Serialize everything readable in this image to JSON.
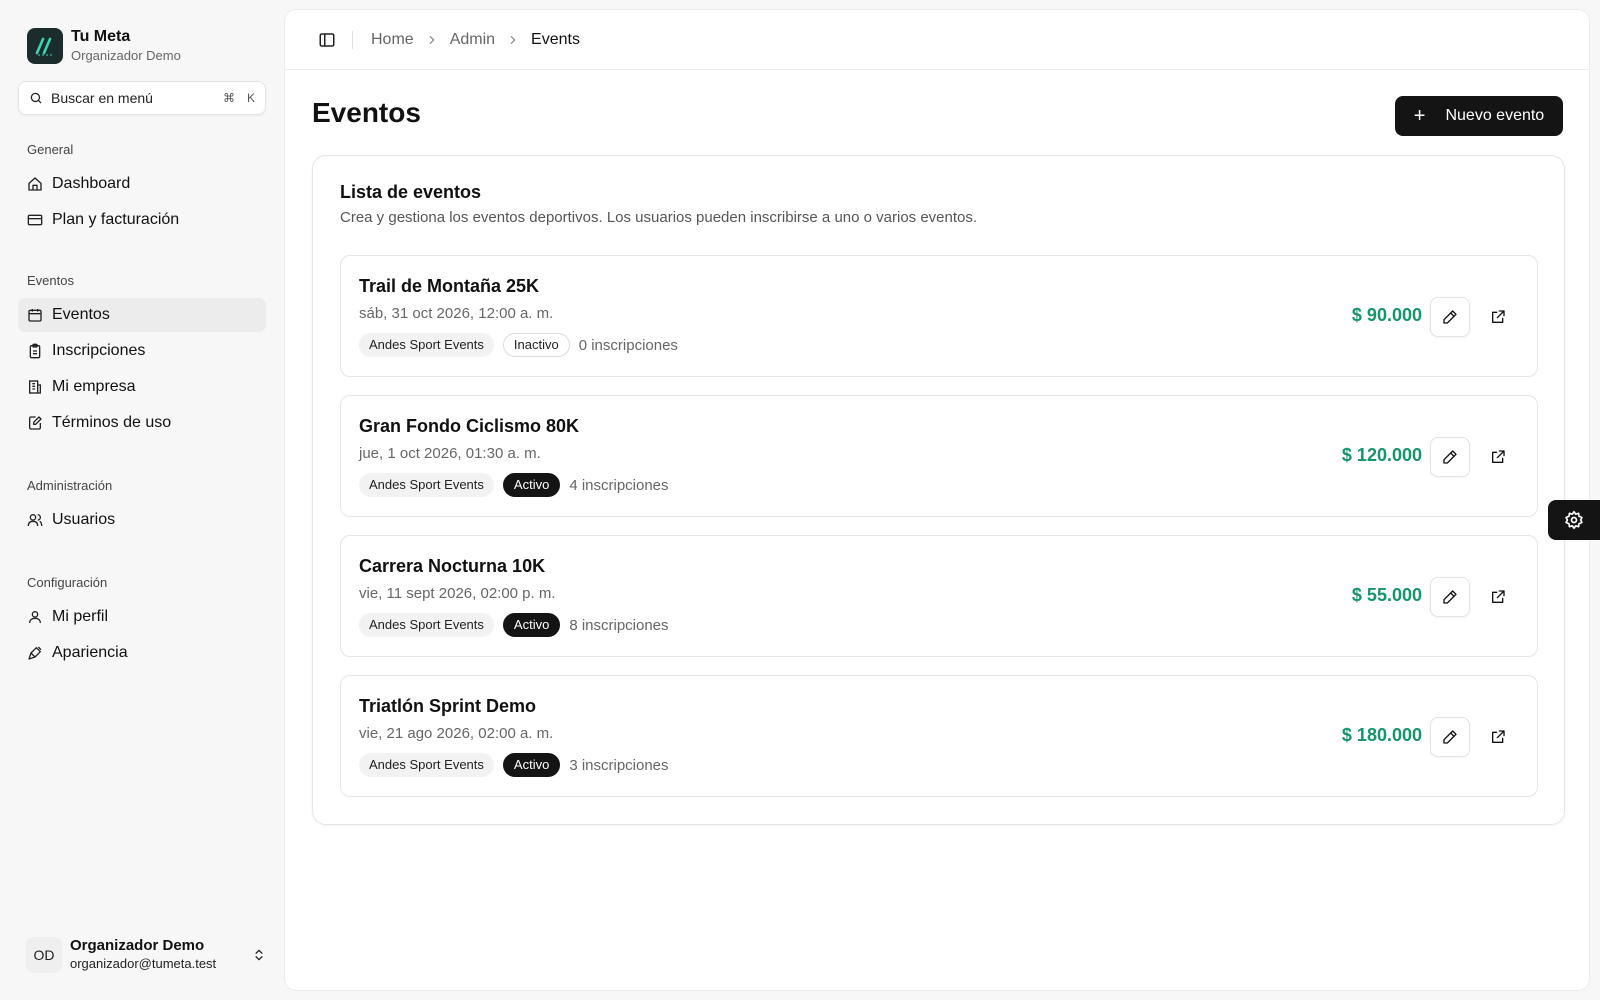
{
  "brand": {
    "name": "Tu Meta",
    "subtitle": "Organizador Demo"
  },
  "search": {
    "label": "Buscar en menú",
    "kbd_cmd": "⌘",
    "kbd_key": "K"
  },
  "nav": {
    "general": {
      "label": "General",
      "items": [
        "Dashboard",
        "Plan y facturación"
      ]
    },
    "eventos": {
      "label": "Eventos",
      "items": [
        "Eventos",
        "Inscripciones",
        "Mi empresa",
        "Términos de uso"
      ]
    },
    "admin": {
      "label": "Administración",
      "items": [
        "Usuarios"
      ]
    },
    "config": {
      "label": "Configuración",
      "items": [
        "Mi perfil",
        "Apariencia"
      ]
    }
  },
  "user": {
    "initials": "OD",
    "name": "Organizador Demo",
    "email": "organizador@tumeta.test"
  },
  "breadcrumb": [
    "Home",
    "Admin",
    "Events"
  ],
  "page": {
    "title": "Eventos",
    "new_button": "Nuevo evento"
  },
  "list": {
    "title": "Lista de eventos",
    "description": "Crea y gestiona los eventos deportivos. Los usuarios pueden inscribirse a uno o varios eventos."
  },
  "events": [
    {
      "title": "Trail de Montaña 25K",
      "date": "sáb, 31 oct 2026, 12:00 a. m.",
      "organizer": "Andes Sport Events",
      "status": "Inactivo",
      "registrations": "0 inscripciones",
      "price": "$ 90.000"
    },
    {
      "title": "Gran Fondo Ciclismo 80K",
      "date": "jue, 1 oct 2026, 01:30 a. m.",
      "organizer": "Andes Sport Events",
      "status": "Activo",
      "registrations": "4 inscripciones",
      "price": "$ 120.000"
    },
    {
      "title": "Carrera Nocturna 10K",
      "date": "vie, 11 sept 2026, 02:00 p. m.",
      "organizer": "Andes Sport Events",
      "status": "Activo",
      "registrations": "8 inscripciones",
      "price": "$ 55.000"
    },
    {
      "title": "Triatlón Sprint Demo",
      "date": "vie, 21 ago 2026, 02:00 a. m.",
      "organizer": "Andes Sport Events",
      "status": "Activo",
      "registrations": "3 inscripciones",
      "price": "$ 180.000"
    }
  ],
  "colors": {
    "price": "#13966b",
    "accent": "#141414",
    "logo_bg": "#1c2b2b",
    "logo_stroke": "#3ad6b0"
  }
}
